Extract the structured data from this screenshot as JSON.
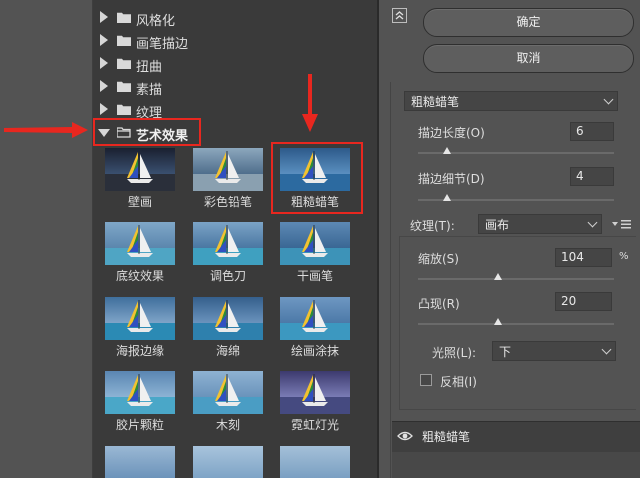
{
  "tree": {
    "folders": [
      {
        "label": "风格化",
        "open": false
      },
      {
        "label": "画笔描边",
        "open": false
      },
      {
        "label": "扭曲",
        "open": false
      },
      {
        "label": "素描",
        "open": false
      },
      {
        "label": "纹理",
        "open": false
      },
      {
        "label": "艺术效果",
        "open": true
      }
    ],
    "filters": [
      "壁画",
      "彩色铅笔",
      "粗糙蜡笔",
      "底纹效果",
      "调色刀",
      "干画笔",
      "海报边缘",
      "海绵",
      "绘画涂抹",
      "胶片颗粒",
      "木刻",
      "霓虹灯光"
    ],
    "selected_filter": "粗糙蜡笔"
  },
  "buttons": {
    "ok": "确定",
    "cancel": "取消"
  },
  "filter_select": "粗糙蜡笔",
  "params": {
    "stroke_length": {
      "label": "描边长度(O)",
      "value": "6",
      "slider": 0.15
    },
    "stroke_detail": {
      "label": "描边细节(D)",
      "value": "4",
      "slider": 0.15
    },
    "texture": {
      "label": "纹理(T):",
      "value": "画布"
    },
    "scaling": {
      "label": "缩放(S)",
      "value": "104",
      "unit": "%",
      "slider": 0.41
    },
    "relief": {
      "label": "凸现(R)",
      "value": "20",
      "slider": 0.41
    },
    "light": {
      "label": "光照(L):",
      "value": "下"
    },
    "invert": {
      "label": "反相(I)",
      "checked": false
    }
  },
  "layer": {
    "name": "粗糙蜡笔"
  },
  "colors": {
    "highlight": "#e8271f",
    "panel_dark": "#3a3a3a",
    "bg": "#535353"
  }
}
